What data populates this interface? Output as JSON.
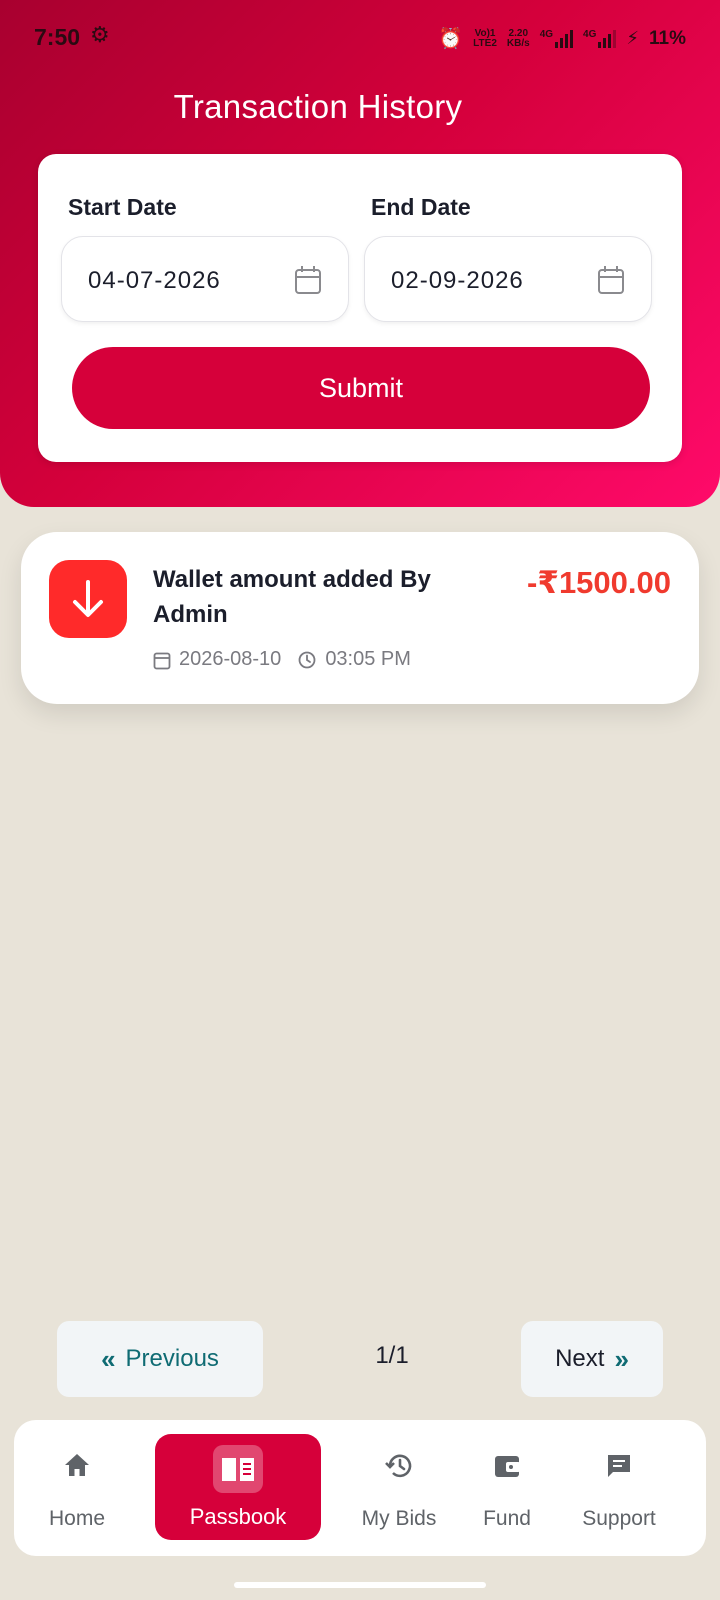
{
  "status_bar": {
    "time": "7:50",
    "net_top": "Vo)1",
    "net_bottom": "LTE2",
    "speed_top": "2.20",
    "speed_bottom": "KB/s",
    "sim1": "4G",
    "sim2": "4G",
    "battery": "11%"
  },
  "header": {
    "title": "Transaction History"
  },
  "filter": {
    "start_label": "Start Date",
    "start_value": "04-07-2026",
    "end_label": "End Date",
    "end_value": "02-09-2026",
    "submit_label": "Submit"
  },
  "transactions": [
    {
      "title": "Wallet amount added By Admin",
      "amount": "-₹1500.00",
      "date": "2026-08-10",
      "time": "03:05 PM",
      "icon": "arrow-down-icon"
    }
  ],
  "pagination": {
    "previous_label": "Previous",
    "page": "1/1",
    "next_label": "Next"
  },
  "bottom_nav": {
    "items": [
      {
        "label": "Home",
        "icon": "home-icon"
      },
      {
        "label": "Passbook",
        "icon": "book-icon",
        "active": true
      },
      {
        "label": "My Bids",
        "icon": "history-icon"
      },
      {
        "label": "Fund",
        "icon": "wallet-icon"
      },
      {
        "label": "Support",
        "icon": "chat-icon"
      }
    ]
  },
  "colors": {
    "primary": "#d6003a",
    "amount_negative": "#f03a2e",
    "txn_icon_bg": "#ff2a2a",
    "background": "#e8e3d8",
    "teal": "#0f6b73"
  }
}
